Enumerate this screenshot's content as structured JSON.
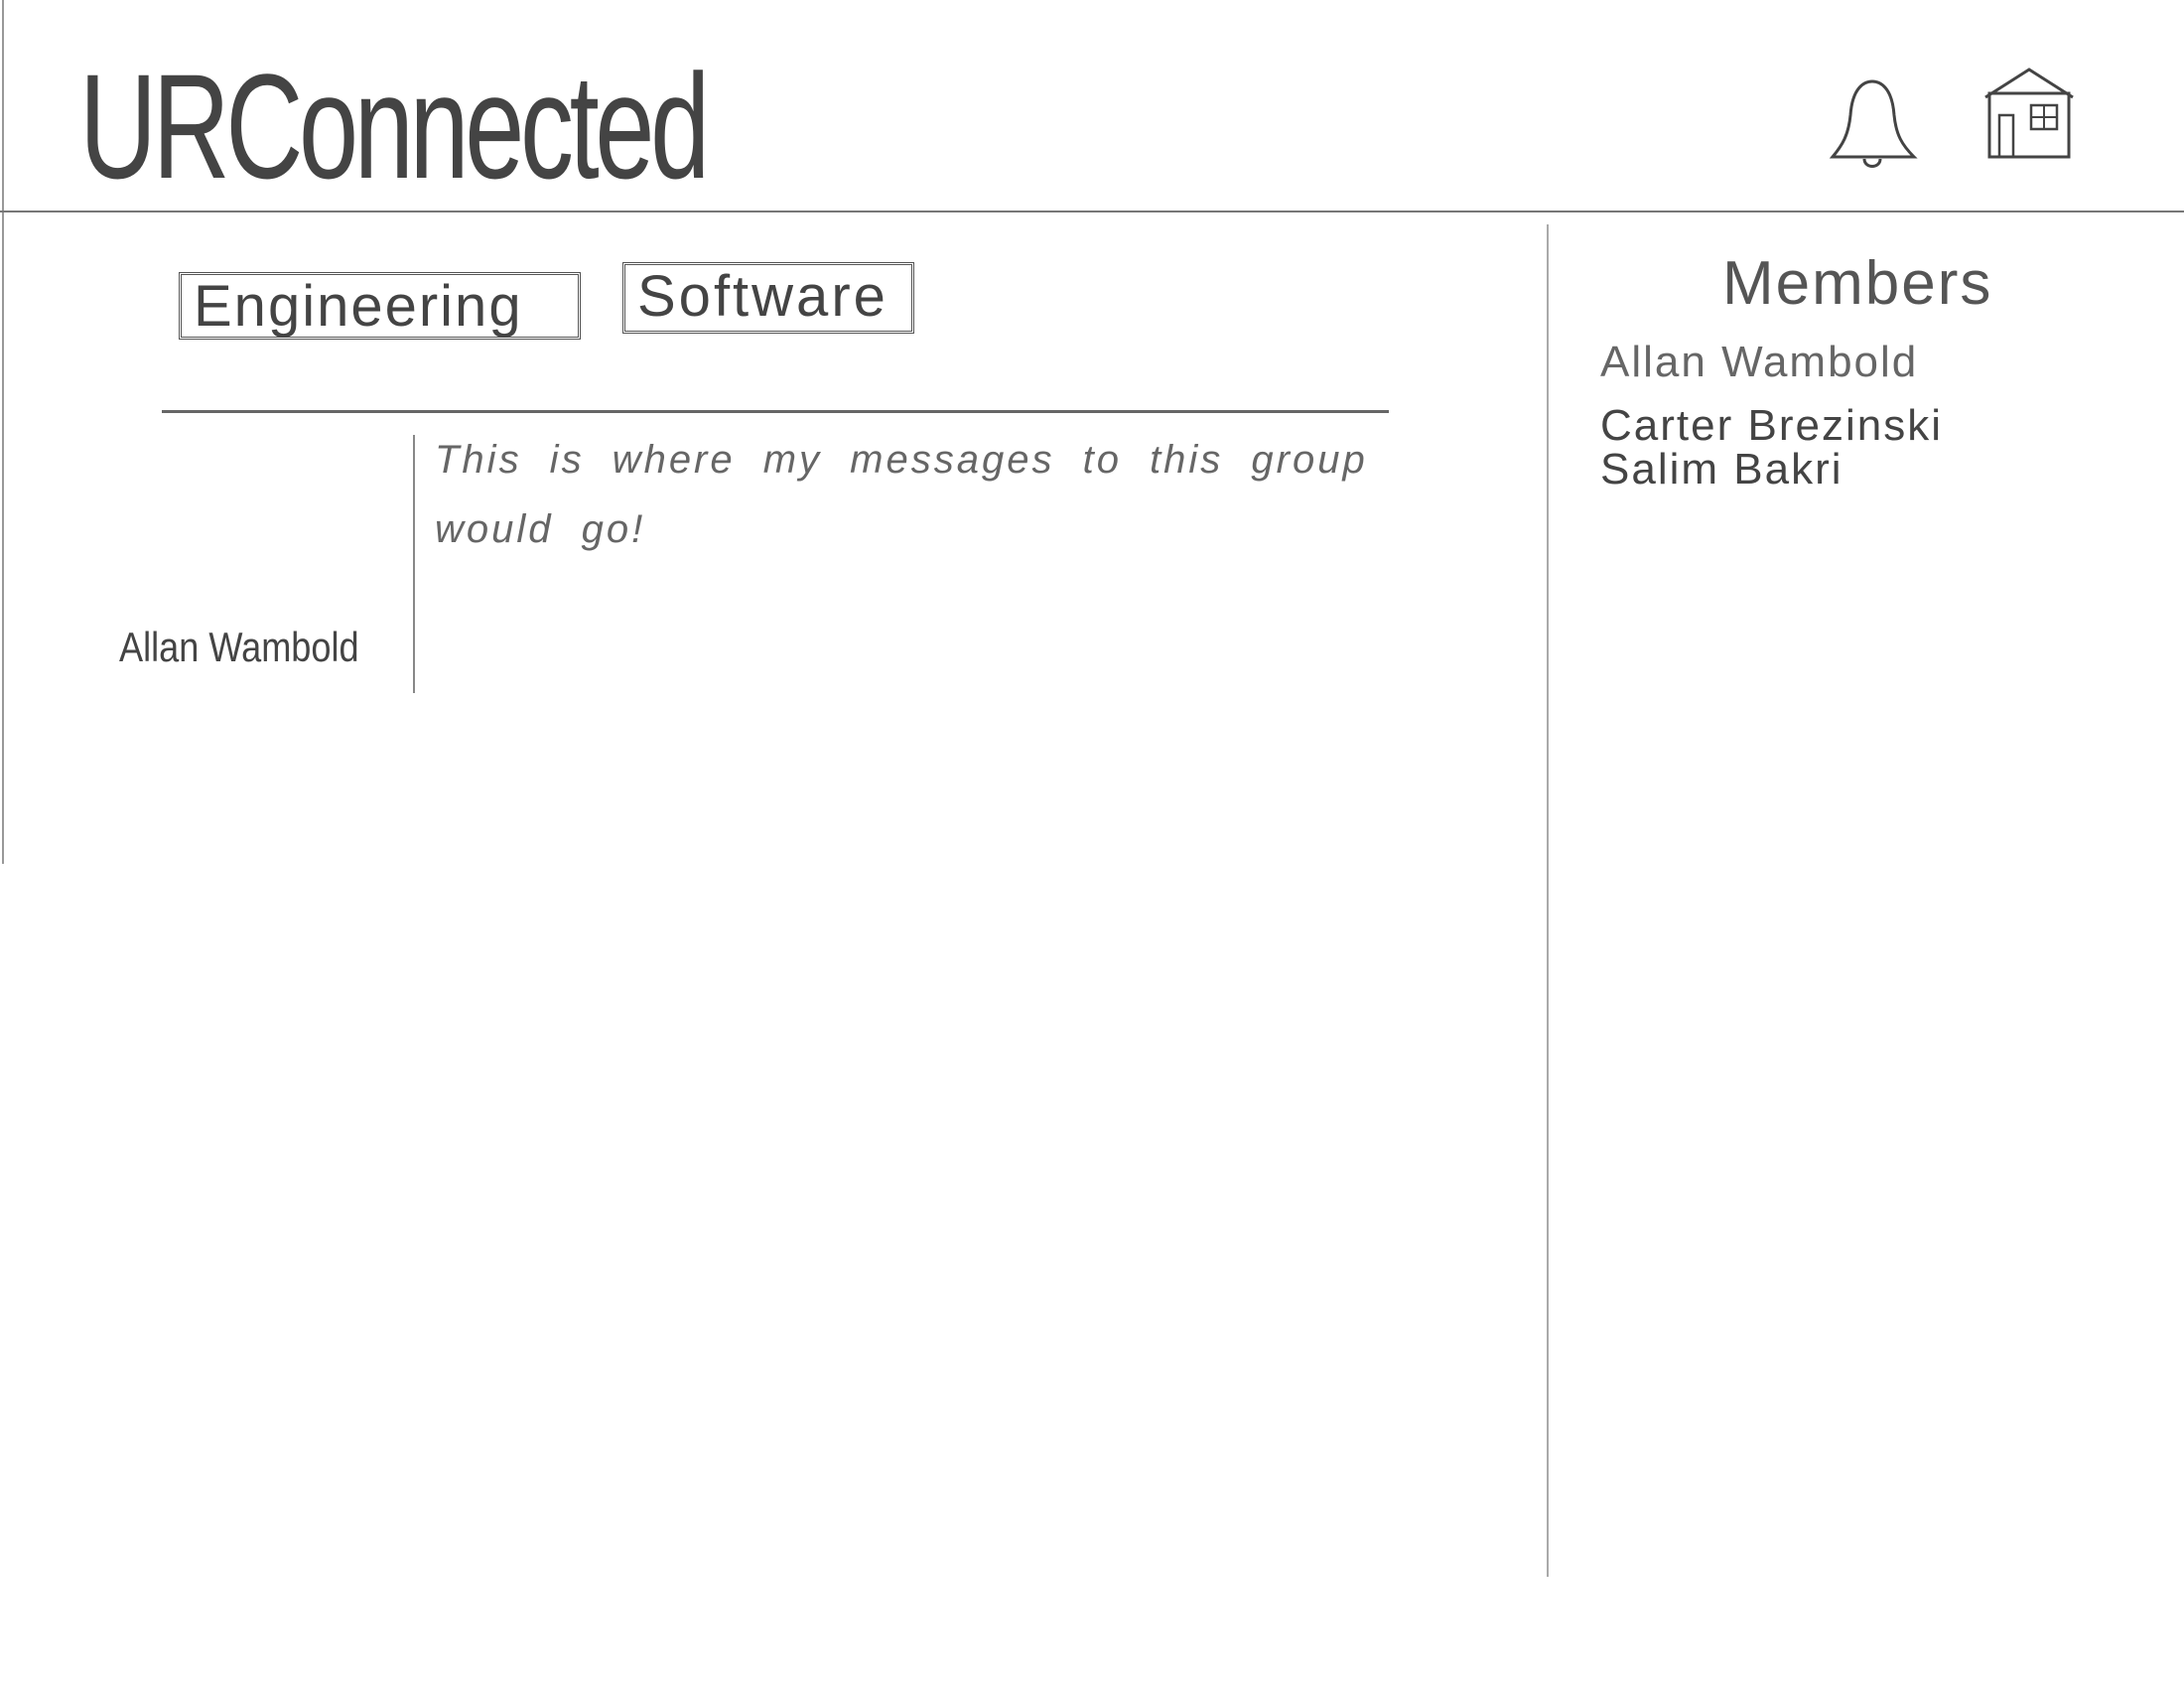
{
  "header": {
    "app_title": "URConnected",
    "icons": [
      "bell-icon",
      "home-icon"
    ]
  },
  "group": {
    "tags": [
      "Engineering",
      "Software"
    ]
  },
  "messages": [
    {
      "author": "Allan Wambold",
      "text": "This is where my messages to this group would go!"
    }
  ],
  "members": {
    "title": "Members",
    "list": [
      "Allan Wambold",
      "Carter Brezinski",
      "Salim Bakri"
    ]
  }
}
